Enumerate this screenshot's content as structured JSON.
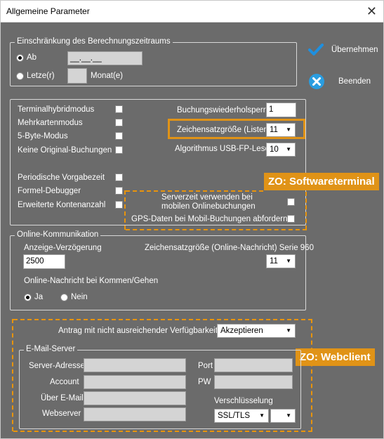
{
  "window": {
    "title": "Allgemeine Parameter",
    "close": "✕"
  },
  "actions": {
    "accept": "Übernehmen",
    "exit": "Beenden"
  },
  "period": {
    "legend": "Einschränkung des Berechnungszeitraums",
    "from_label": "Ab",
    "from_value": "__.__.__",
    "last_label": "Letze(r)",
    "months_value": "",
    "months_label": "Monat(e)",
    "selected": "Ab"
  },
  "modes": {
    "terminalhybrid": "Terminalhybridmodus",
    "multicard": "Mehrkartenmodus",
    "byte5": "5-Byte-Modus",
    "no_original": "Keine Original-Buchungen",
    "periodic": "Periodische Vorgabezeit",
    "formula_debugger": "Formel-Debugger",
    "ext_accounts": "Erweiterte Kontenanzahl",
    "booking_repeat_label": "Buchungswiederholsperre",
    "booking_repeat_value": "1",
    "charset_size_label": "Zeichensatzgröße (Listen)",
    "charset_size_value": "11",
    "algorithm_label": "Algorithmus USB-FP-Leser",
    "algorithm_value": "10",
    "server_time": "Serverzeit verwenden bei mobilen Onlinebuchungen",
    "gps": "GPS-Daten bei Mobil-Buchungen abfordern"
  },
  "badges": {
    "softwareterminal": "ZO: Softwareterminal",
    "webclient": "ZO: Webclient"
  },
  "online": {
    "legend": "Online-Kommunikation",
    "delay_label": "Anzeige-Verzögerung",
    "delay_value": "2500",
    "charset_label": "Zeichensatzgröße (Online-Nachricht) Serie 960",
    "charset_value": "11",
    "message_label": "Online-Nachricht bei Kommen/Gehen",
    "yes": "Ja",
    "no": "Nein",
    "selected": "Ja"
  },
  "web": {
    "insufficient_label": "Antrag mit nicht ausreichender Verfügbarkeit",
    "insufficient_value": "Akzeptieren",
    "mail_legend": "E-Mail-Server",
    "server_address": "Server-Adresse",
    "account": "Account",
    "via_email": "Über E-Mail",
    "webserver": "Webserver",
    "port": "Port",
    "pw": "PW",
    "encryption_label": "Verschlüsselung",
    "encryption_value": "SSL/TLS",
    "encryption_extra": ""
  },
  "colors": {
    "accent": "#e09317",
    "check_blue": "#1e90e0",
    "exit_blue": "#2a9de0"
  }
}
